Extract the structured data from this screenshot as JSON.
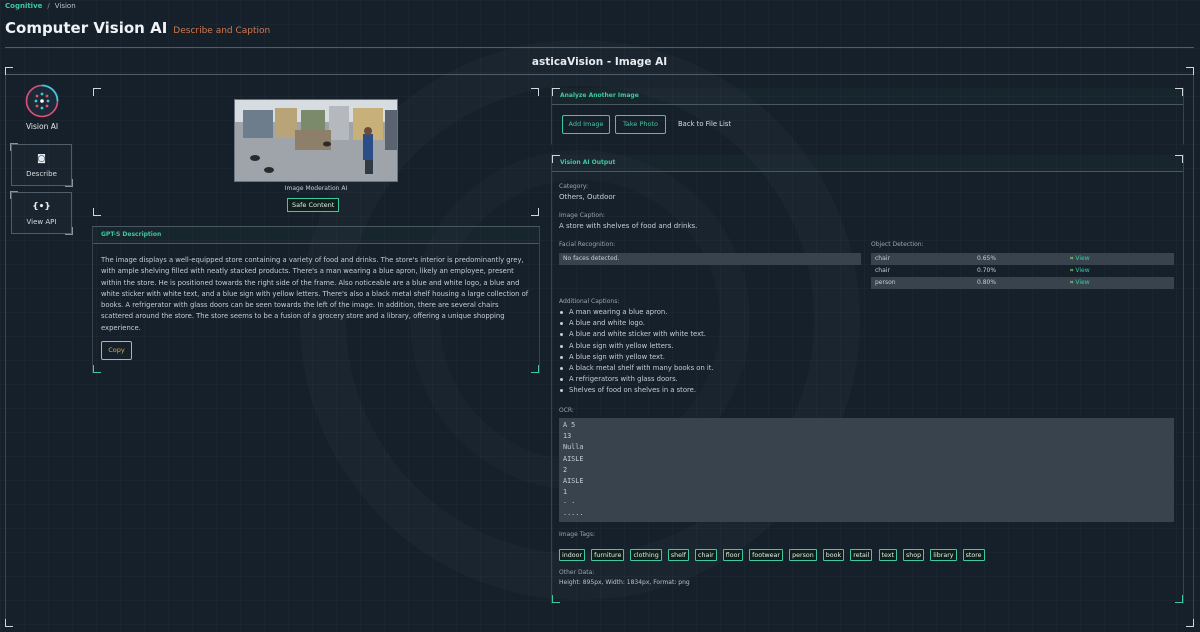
{
  "breadcrumb": {
    "root": "Cognitive",
    "separator": "/",
    "current": "Vision"
  },
  "page": {
    "title": "Computer Vision AI",
    "subtitle": "Describe and Caption"
  },
  "frame": {
    "title": "asticaVision - Image AI"
  },
  "sidebar": {
    "label": "Vision AI",
    "buttons": [
      {
        "label": "Describe",
        "icon": "image-icon",
        "glyph": "◙"
      },
      {
        "label": "View API",
        "icon": "code-icon",
        "glyph": "{•}"
      }
    ]
  },
  "preview": {
    "caption_label": "Image Moderation AI",
    "badge": "Safe Content"
  },
  "description": {
    "heading": "GPT-S Description",
    "text": "The image displays a well-equipped store containing a variety of food and drinks. The store's interior is predominantly grey, with ample shelving filled with neatly stacked products. There's a man wearing a blue apron, likely an employee, present within the store. He is positioned towards the right side of the frame. Also noticeable are a blue and white logo, a blue and white sticker with white text, and a blue sign with yellow letters. There's also a black metal shelf housing a large collection of books. A refrigerator with glass doors can be seen towards the left of the image. In addition, there are several chairs scattered around the store. The store seems to be a fusion of a grocery store and a library, offering a unique shopping experience.",
    "copy_label": "Copy"
  },
  "analyze": {
    "heading": "Analyze Another Image",
    "add_label": "Add Image",
    "photo_label": "Take Photo",
    "back_label": "Back to File List"
  },
  "output": {
    "heading": "Vision AI Output",
    "category_label": "Category:",
    "category_value": "Others, Outdoor",
    "caption_label": "Image Caption:",
    "caption_value": "A store with shelves of food and drinks.",
    "facial_label": "Facial Recognition:",
    "facial_value": "No faces detected.",
    "object_label": "Object Detection:",
    "objects": [
      {
        "name": "chair",
        "pct": "0.65%",
        "view": "View"
      },
      {
        "name": "chair",
        "pct": "0.70%",
        "view": "View"
      },
      {
        "name": "person",
        "pct": "0.80%",
        "view": "View"
      }
    ],
    "additional_label": "Additional Captions:",
    "additional": [
      "A man wearing a blue apron.",
      "A blue and white logo.",
      "A blue and white sticker with white text.",
      "A blue sign with yellow letters.",
      "A blue sign with yellow text.",
      "A black metal shelf with many books on it.",
      "A refrigerators with glass doors.",
      "Shelves of food on shelves in a store."
    ],
    "ocr_label": "OCR:",
    "ocr": [
      "A 5",
      "13",
      "Nulla",
      "AISLE",
      "2",
      "AISLE",
      "1",
      "· ·",
      "·····"
    ],
    "tags_label": "Image Tags:",
    "tags": [
      "indoor",
      "furniture",
      "clothing",
      "shelf",
      "chair",
      "floor",
      "footwear",
      "person",
      "book",
      "retail",
      "text",
      "shop",
      "library",
      "store"
    ],
    "other_label": "Other Data:",
    "other_value": "Height: 895px, Width: 1834px, Format: png"
  },
  "colors": {
    "accent": "#3ec9a0",
    "subtitle": "#d0784e",
    "copy": "#d4b24a",
    "background": "#16202a"
  }
}
